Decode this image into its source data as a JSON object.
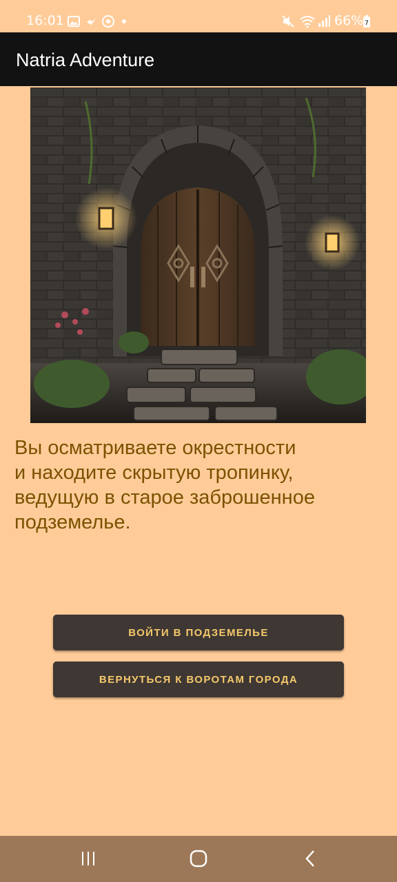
{
  "status_bar": {
    "time": "16:01",
    "battery": "66%",
    "icons": [
      "gallery-icon",
      "bird-icon",
      "sync-icon",
      "dot-icon",
      "mute-icon",
      "wifi-icon",
      "signal-icon",
      "battery-icon"
    ]
  },
  "app_bar": {
    "title": "Natria Adventure"
  },
  "scene": {
    "description_icon": "dungeon-door-image"
  },
  "story": {
    "text": "Вы осматриваете окрестности\nи находите скрытую тропинку,\nведущую в старое заброшенное\nподземелье."
  },
  "choices": [
    {
      "label": "ВОЙТИ В ПОДЗЕМЕЛЬЕ"
    },
    {
      "label": "ВЕРНУТЬСЯ К ВОРОТАМ ГОРОДА"
    }
  ],
  "nav_bar": {
    "buttons": [
      "recents-icon",
      "home-icon",
      "back-icon"
    ]
  },
  "colors": {
    "background": "#ffcc99",
    "app_bar": "#121212",
    "story_text": "#7a5200",
    "button_bg": "#3e3734",
    "button_text": "#f5c96b",
    "nav_bar": "#9c7858"
  }
}
